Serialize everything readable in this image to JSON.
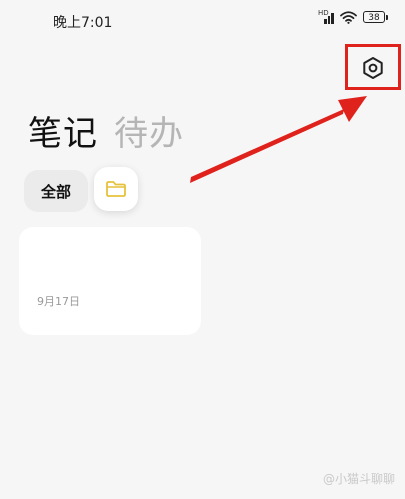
{
  "status_bar": {
    "time": "晚上7:01",
    "network": "HD",
    "battery": "38"
  },
  "header": {
    "tabs": [
      {
        "label": "笔记",
        "active": true
      },
      {
        "label": "待办",
        "active": false
      }
    ],
    "settings_icon": "settings-hexagon-icon"
  },
  "folders": {
    "all_label": "全部",
    "folder_icon": "folder-icon",
    "folder_icon_color": "#e6c23a"
  },
  "notes": [
    {
      "date": "9月17日"
    }
  ],
  "annotation": {
    "highlight_color": "#e0221d"
  },
  "watermark": "@小猫斗聊聊"
}
